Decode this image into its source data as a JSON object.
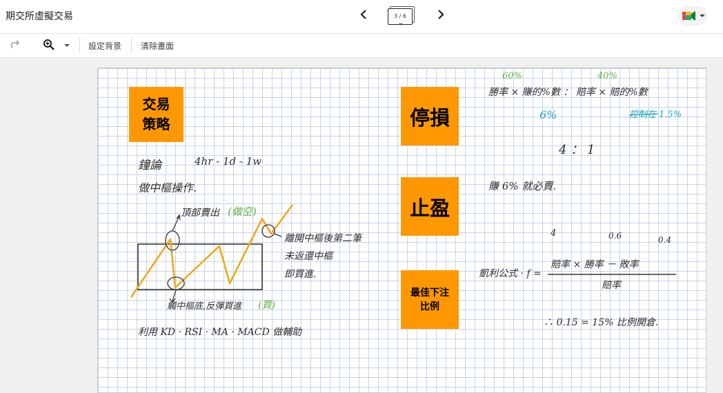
{
  "header": {
    "title": "期交所虛擬交易",
    "page_indicator": "3 / 6"
  },
  "toolbar": {
    "set_background": "設定背景",
    "clear_frame": "清除畫面"
  },
  "icons": {
    "prev": "chevron-left-icon",
    "next": "chevron-right-icon",
    "redo": "redo-icon",
    "zoom": "zoom-in-icon",
    "meet": "google-meet-icon"
  },
  "canvas": {
    "notes": {
      "strategy": "交易\n策略",
      "stop_loss": "停損",
      "take_profit": "止盈",
      "kelly": "最佳下注\n比例"
    },
    "handwriting": {
      "timeframe_label": "鐘論",
      "timeframe": "4hr - 1d - 1w",
      "range_trade": "做中樞操作.",
      "top_sell": "頂部賣出",
      "top_sell_note": "(做空)",
      "breakout_line1": "離開中樞後第二筆",
      "breakout_line2": "未返還中樞",
      "breakout_line3": "即買進.",
      "bottom_buy": "觸中樞底,反彈買進",
      "bottom_buy_note": "(買)",
      "indicators": "利用 KD · RSI · MA · MACD 做輔助",
      "winrate_formula": "勝率 × 賺的%數 ： 賠率 × 賠的%數",
      "p60": "60%",
      "p40": "40%",
      "p6": "6%",
      "stop_line": "控制在 1.5%",
      "ratio": "4 ： 1",
      "take_profit_rule": "賺 6% 就必賣.",
      "kelly_formula": "凱利公式 · f =",
      "kelly_numerator": "賠率 × 勝率 － 敗率",
      "kelly_denominator": "賠率",
      "kelly_n1": "4",
      "kelly_n2": "0.6",
      "kelly_n3": "0.4",
      "kelly_result": "∴ 0.15 = 15% 比例開倉."
    }
  },
  "colors": {
    "note_orange": "#ff9800",
    "chart_line": "#f0a81c",
    "green_ink": "#5fae3a",
    "teal_ink": "#1ba3bd",
    "grid": "#c6d3ea"
  }
}
